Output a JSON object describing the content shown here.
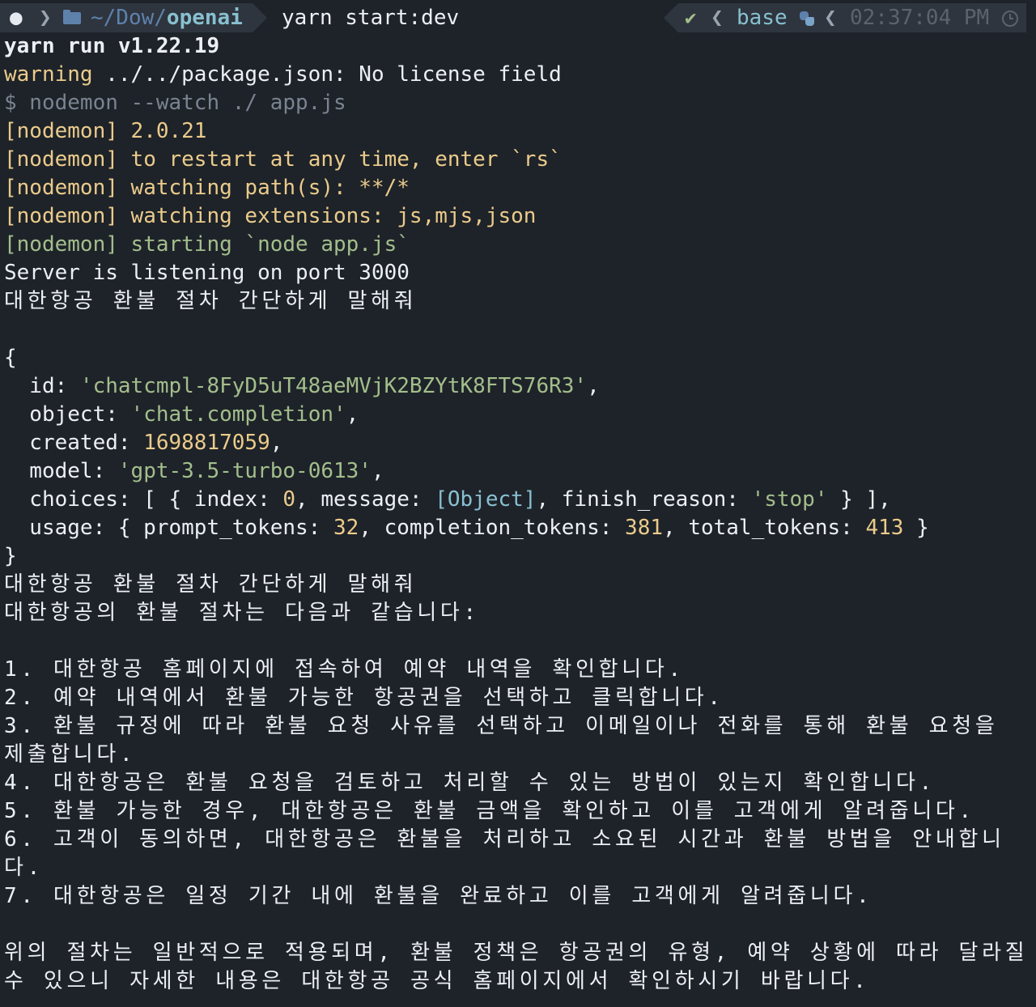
{
  "prompt": {
    "path_home": "~/Dow/",
    "path_current": "openai",
    "command": "yarn start:dev",
    "status_check": "✔",
    "env_name": "base",
    "time": "02:37:04 PM"
  },
  "yarn": {
    "version_line": "yarn run v1.22.19",
    "warning_word": "warning",
    "warning_text": " ../../package.json: No license field",
    "exec_line": "$ nodemon --watch ./ app.js"
  },
  "nodemon": {
    "tag": "[nodemon]",
    "version": " 2.0.21",
    "restart": " to restart at any time, enter `rs`",
    "watching_paths": " watching path(s): **/*",
    "watching_ext": " watching extensions: js,mjs,json",
    "starting": " starting `node app.js`"
  },
  "server_line": "Server is listening on port 3000",
  "query": "대한항공 환불 절차 간단하게 말해줘",
  "response": {
    "open_brace": "{",
    "close_brace": "}",
    "id_key": "  id: ",
    "id_val": "'chatcmpl-8FyD5uT48aeMVjK2BZYtK8FTS76R3'",
    "object_key": "  object: ",
    "object_val": "'chat.completion'",
    "created_key": "  created: ",
    "created_val": "1698817059",
    "model_key": "  model: ",
    "model_val": "'gpt-3.5-turbo-0613'",
    "choices_key": "  choices: [ { index: ",
    "choices_index": "0",
    "choices_mid": ", message: ",
    "choices_msg": "[Object]",
    "choices_finish": ", finish_reason: ",
    "choices_reason": "'stop'",
    "choices_end": " } ],",
    "usage_key": "  usage: { prompt_tokens: ",
    "usage_prompt": "32",
    "usage_mid1": ", completion_tokens: ",
    "usage_completion": "381",
    "usage_mid2": ", total_tokens: ",
    "usage_total": "413",
    "usage_end": " }",
    "comma": ","
  },
  "answer": {
    "query_echo": "대한항공 환불 절차 간단하게 말해줘",
    "intro": "대한항공의 환불 절차는 다음과 같습니다:",
    "steps": [
      "1. 대한항공 홈페이지에 접속하여 예약 내역을 확인합니다.",
      "2. 예약 내역에서 환불 가능한 항공권을 선택하고 클릭합니다.",
      "3. 환불 규정에 따라 환불 요청 사유를 선택하고 이메일이나 전화를 통해 환불 요청을 제출합니다.",
      "4. 대한항공은 환불 요청을 검토하고 처리할 수 있는 방법이 있는지 확인합니다.",
      "5. 환불 가능한 경우, 대한항공은 환불 금액을 확인하고 이를 고객에게 알려줍니다.",
      "6. 고객이 동의하면, 대한항공은 환불을 처리하고 소요된 시간과 환불 방법을 안내합니다.",
      "7. 대한항공은 일정 기간 내에 환불을 완료하고 이를 고객에게 알려줍니다."
    ],
    "closing": "위의 절차는 일반적으로 적용되며, 환불 정책은 항공권의 유형, 예약 상황에 따라 달라질 수 있으니 자세한 내용은 대한항공 공식 홈페이지에서 확인하시기 바랍니다."
  }
}
